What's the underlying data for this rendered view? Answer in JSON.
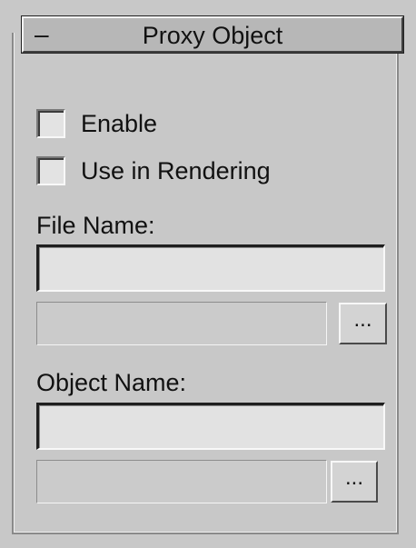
{
  "panel": {
    "toggle_symbol": "–",
    "title": "Proxy Object"
  },
  "checkboxes": [
    {
      "label": "Enable",
      "checked": false
    },
    {
      "label": "Use in Rendering",
      "checked": false
    }
  ],
  "file_section": {
    "label": "File Name:",
    "value": "",
    "path_value": "",
    "browse_label": "..."
  },
  "object_section": {
    "label": "Object Name:",
    "value": "",
    "path_value": "",
    "browse_label": "..."
  }
}
